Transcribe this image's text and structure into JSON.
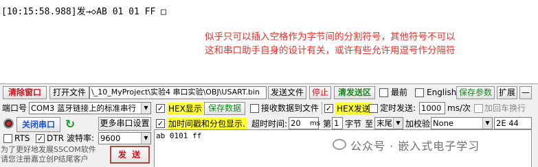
{
  "log": {
    "line": "[10:15:58.988]发→◇AB 01 01 FF □"
  },
  "note": {
    "line1": "似乎只可以插入空格作为字节间的分割符号，其他符号不可以",
    "line2": "这和串口助手自身的设计有关，或许有些允许用逗号作分隔符"
  },
  "toolbar": {
    "clear_window": "清除窗口",
    "open_file": "打开文件",
    "file_path": "\\_10_MyProject\\实验4 串口实验\\OBJ\\USART.bin",
    "send_file": "发送文件",
    "stop": "停止",
    "clear_send_area": "清发送区",
    "topmost": "最前",
    "english": "English",
    "save_params": "保存参数",
    "expand": "扩展",
    "minus": "—"
  },
  "port": {
    "label": "端口号",
    "value": "COM3 蓝牙链接上的标准串行",
    "close_port": "关闭串口",
    "more_settings": "更多串口设置",
    "rts": "RTS",
    "dtr": "DTR",
    "baud_label": "波特率:",
    "baud_value": "9600"
  },
  "recv_options": {
    "hex_display": "HEX显示",
    "save_data": "保存数据",
    "recv_to_file": "接收数据到文件",
    "timestamp": "加时间戳和分包显示.",
    "timeout_label": "超时时间:",
    "timeout_value": "20",
    "timeout_unit": "ms",
    "byte_prefix": "第",
    "byte_index": "1",
    "byte_unit": "字节",
    "to": "至",
    "end": "末尾"
  },
  "send_options": {
    "hex_send": "HEX发送",
    "timed_send": "定时发送:",
    "interval": "1000",
    "interval_unit": "ms/次",
    "add_crlf": "加回车换行",
    "checksum_label": "加校验",
    "checksum_value": "None",
    "checksum_result": "2E 44"
  },
  "send_button": "发  送",
  "send_box": "ab 0101 ff",
  "promo": {
    "line1": "为了更好地发展SSCOM软件",
    "line2": "请您注册嘉立创P结尾客户"
  },
  "watermark": "公众号 · 嵌入式电子学习"
}
